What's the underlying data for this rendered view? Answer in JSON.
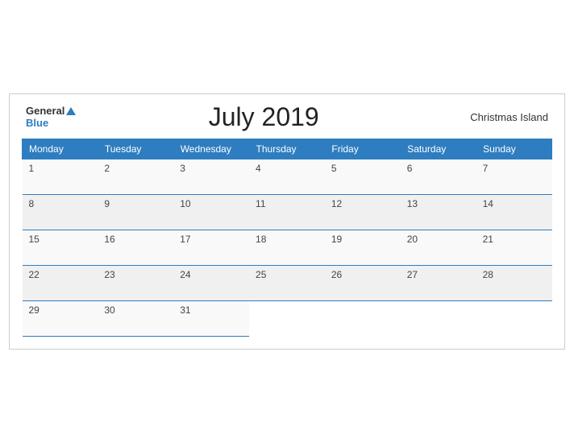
{
  "header": {
    "logo_general": "General",
    "logo_blue": "Blue",
    "title": "July 2019",
    "location": "Christmas Island"
  },
  "days_of_week": [
    "Monday",
    "Tuesday",
    "Wednesday",
    "Thursday",
    "Friday",
    "Saturday",
    "Sunday"
  ],
  "weeks": [
    [
      "1",
      "2",
      "3",
      "4",
      "5",
      "6",
      "7"
    ],
    [
      "8",
      "9",
      "10",
      "11",
      "12",
      "13",
      "14"
    ],
    [
      "15",
      "16",
      "17",
      "18",
      "19",
      "20",
      "21"
    ],
    [
      "22",
      "23",
      "24",
      "25",
      "26",
      "27",
      "28"
    ],
    [
      "29",
      "30",
      "31",
      "",
      "",
      "",
      ""
    ]
  ]
}
